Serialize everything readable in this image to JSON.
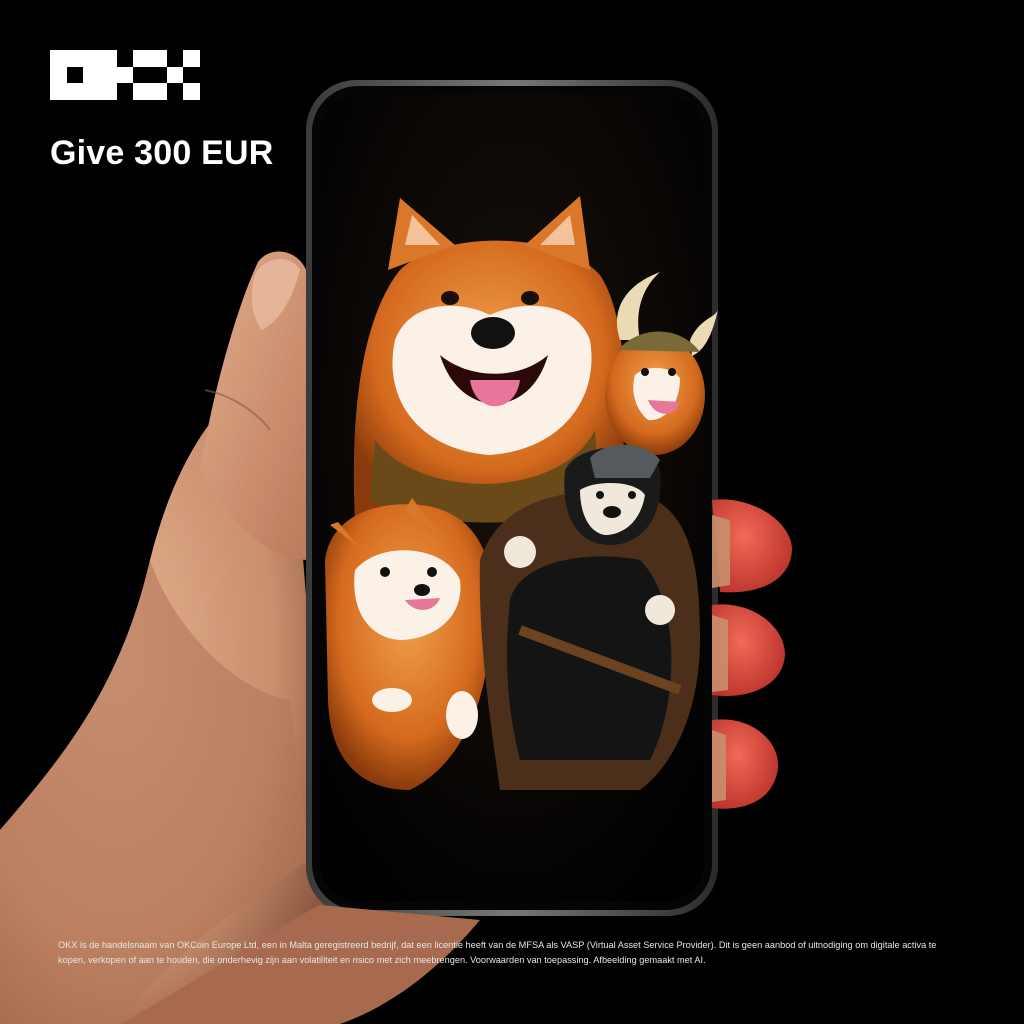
{
  "brand": {
    "logo_text": "OKX"
  },
  "headline": "Give 300 EUR",
  "disclaimer": "OKX is de handelsnaam van OKCoin Europe Ltd, een in Malta geregistreerd bedrijf, dat een licentie heeft van de MFSA als VASP (Virtual Asset Service Provider). Dit is geen aanbod of uitnodiging om digitale activa te kopen, verkopen of aan te houden, die onderhevig zijn aan volatiliteit en risico met zich meebrengen. Voorwaarden van toepassing. Afbeelding gemaakt met AI.",
  "colors": {
    "background": "#000000",
    "text": "#ffffff",
    "dog_orange": "#d9782a",
    "skin": "#d9a07e"
  }
}
